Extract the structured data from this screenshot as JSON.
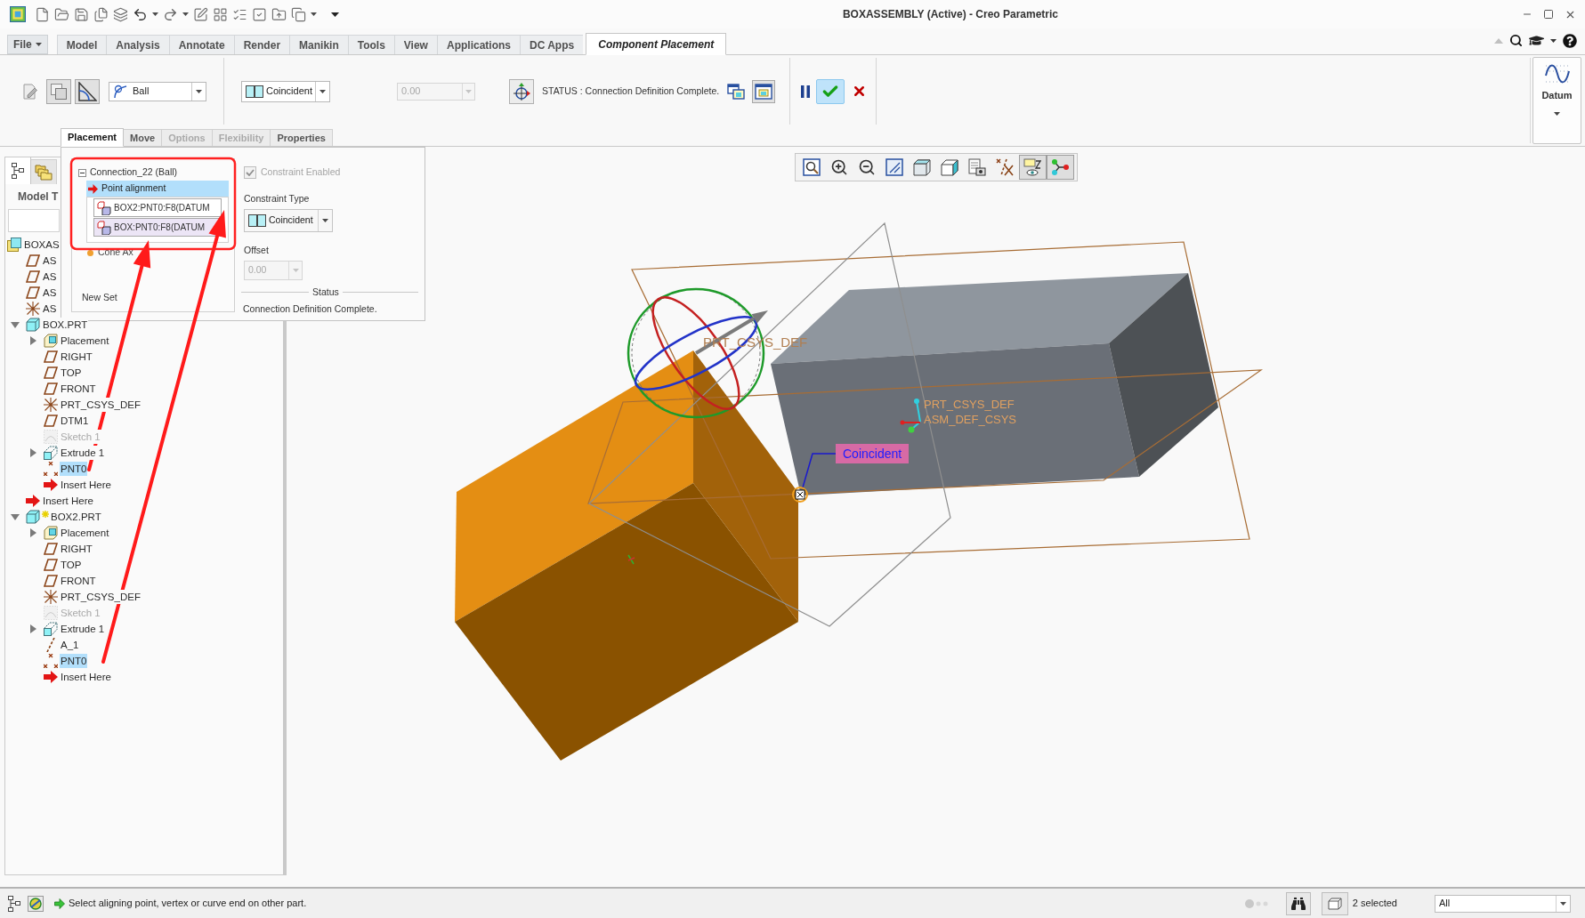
{
  "window": {
    "title": "BOXASSEMBLY (Active) - Creo Parametric"
  },
  "ribbon_tabs": [
    {
      "label": "File",
      "kind": "menu",
      "selected": false
    },
    {
      "label": "Model",
      "kind": "tab",
      "selected": false
    },
    {
      "label": "Analysis",
      "kind": "tab",
      "selected": false
    },
    {
      "label": "Annotate",
      "kind": "tab",
      "selected": false
    },
    {
      "label": "Render",
      "kind": "tab",
      "selected": false
    },
    {
      "label": "Manikin",
      "kind": "tab",
      "selected": false
    },
    {
      "label": "Tools",
      "kind": "tab",
      "selected": false
    },
    {
      "label": "View",
      "kind": "tab",
      "selected": false
    },
    {
      "label": "Applications",
      "kind": "tab",
      "selected": false
    },
    {
      "label": "DC Apps",
      "kind": "tab",
      "selected": false
    },
    {
      "label": "Component Placement",
      "kind": "tab",
      "selected": true
    }
  ],
  "ribbon": {
    "toggles": [
      {
        "kind": "edit",
        "on": false
      },
      {
        "kind": "squares",
        "on": true
      },
      {
        "kind": "angle",
        "on": true
      }
    ],
    "connection_type": "Ball",
    "constraint_type": "Coincident",
    "offset": {
      "value": "0.00",
      "disabled": true
    },
    "status": "STATUS : Connection Definition Complete.",
    "windows": [
      {
        "kind": "separate",
        "on": false
      },
      {
        "kind": "assembly",
        "on": true
      }
    ],
    "datum": "Datum"
  },
  "sub_tabs": [
    {
      "label": "Placement",
      "selected": true,
      "disabled": false
    },
    {
      "label": "Move",
      "selected": false,
      "disabled": false
    },
    {
      "label": "Options",
      "selected": false,
      "disabled": true
    },
    {
      "label": "Flexibility",
      "selected": false,
      "disabled": true
    },
    {
      "label": "Properties",
      "selected": false,
      "disabled": false
    }
  ],
  "placement_panel": {
    "connection": {
      "label": "Connection_22 (Ball)",
      "expanded": true
    },
    "constraints": [
      {
        "label": "Point alignment",
        "selected": true
      }
    ],
    "references": [
      {
        "text": "BOX2:PNT0:F8(DATUM",
        "selected": false
      },
      {
        "text": "BOX:PNT0:F8(DATUM",
        "selected": true
      }
    ],
    "other_set": "Cone Ax",
    "new_set": "New Set",
    "constraint_enabled": {
      "label": "Constraint Enabled",
      "checked": true,
      "disabled": true
    },
    "constraint_type": {
      "label": "Constraint Type",
      "value": "Coincident"
    },
    "offset": {
      "label": "Offset",
      "value": "0.00",
      "disabled": true
    },
    "status": {
      "label": "Status",
      "text": "Connection Definition Complete."
    }
  },
  "model_tree": {
    "view_tabs": [
      {
        "kind": "tree",
        "selected": true
      },
      {
        "kind": "folders",
        "selected": false
      }
    ],
    "title": "Model T",
    "items": [
      {
        "label": "BOXAS",
        "kind": "assembly",
        "selected": false,
        "dimmed": false,
        "children": [
          {
            "label": "AS",
            "kind": "plane",
            "selected": false,
            "dimmed": false
          },
          {
            "label": "AS",
            "kind": "plane",
            "selected": false,
            "dimmed": false
          },
          {
            "label": "AS",
            "kind": "plane",
            "selected": false,
            "dimmed": false
          },
          {
            "label": "AS",
            "kind": "csys",
            "selected": false,
            "dimmed": false
          },
          {
            "label": "BOX.PRT",
            "kind": "part",
            "expanded": true,
            "selected": false,
            "dimmed": false,
            "children": [
              {
                "label": "Placement",
                "kind": "placement",
                "expanded": false,
                "selected": false,
                "dimmed": false
              },
              {
                "label": "RIGHT",
                "kind": "plane",
                "selected": false,
                "dimmed": false
              },
              {
                "label": "TOP",
                "kind": "plane",
                "selected": false,
                "dimmed": false
              },
              {
                "label": "FRONT",
                "kind": "plane",
                "selected": false,
                "dimmed": false
              },
              {
                "label": "PRT_CSYS_DEF",
                "kind": "csys",
                "selected": false,
                "dimmed": false
              },
              {
                "label": "DTM1",
                "kind": "plane",
                "selected": false,
                "dimmed": false
              },
              {
                "label": "Sketch 1",
                "kind": "sketch",
                "selected": false,
                "dimmed": true
              },
              {
                "label": "Extrude 1",
                "kind": "extrude",
                "expanded": false,
                "selected": false,
                "dimmed": false
              },
              {
                "label": "PNT0",
                "kind": "point",
                "selected": true,
                "dimmed": false
              },
              {
                "label": "Insert Here",
                "kind": "insert",
                "selected": false,
                "dimmed": false
              }
            ]
          },
          {
            "label": "Insert Here",
            "kind": "insert",
            "selected": false,
            "dimmed": false
          },
          {
            "label": "BOX2.PRT",
            "kind": "part_placing",
            "expanded": true,
            "selected": false,
            "dimmed": false,
            "children": [
              {
                "label": "Placement",
                "kind": "placement",
                "expanded": false,
                "selected": false,
                "dimmed": false
              },
              {
                "label": "RIGHT",
                "kind": "plane",
                "selected": false,
                "dimmed": false
              },
              {
                "label": "TOP",
                "kind": "plane",
                "selected": false,
                "dimmed": false
              },
              {
                "label": "FRONT",
                "kind": "plane",
                "selected": false,
                "dimmed": false
              },
              {
                "label": "PRT_CSYS_DEF",
                "kind": "csys",
                "selected": false,
                "dimmed": false
              },
              {
                "label": "Sketch 1",
                "kind": "sketch",
                "selected": false,
                "dimmed": true
              },
              {
                "label": "Extrude 1",
                "kind": "extrude",
                "expanded": false,
                "selected": false,
                "dimmed": false
              },
              {
                "label": "A_1",
                "kind": "axis",
                "selected": false,
                "dimmed": false
              },
              {
                "label": "PNT0",
                "kind": "point",
                "selected": true,
                "dimmed": false
              },
              {
                "label": "Insert Here",
                "kind": "insert",
                "selected": false,
                "dimmed": false
              }
            ]
          }
        ]
      }
    ]
  },
  "viewport": {
    "toolbar": [
      {
        "kind": "refit",
        "on": false
      },
      {
        "kind": "zoom_in",
        "on": false
      },
      {
        "kind": "zoom_out",
        "on": false
      },
      {
        "kind": "repaint",
        "on": false
      },
      {
        "kind": "display_style",
        "on": false
      },
      {
        "kind": "saved_orientations",
        "on": false
      },
      {
        "kind": "view_manager",
        "on": false
      },
      {
        "kind": "datum_display",
        "on": false
      },
      {
        "kind": "annotations",
        "on": true
      },
      {
        "kind": "connections",
        "on": true
      }
    ],
    "csys_labels": [
      "PRT_CSYS_DEF",
      "PRT_CSYS_DEF",
      "ASM_DEF_CSYS"
    ],
    "constraint_tag": "Coincident"
  },
  "status_bar": {
    "message": "Select aligning point, vertex or curve end on other part.",
    "selection": "2 selected",
    "filter": "All"
  }
}
